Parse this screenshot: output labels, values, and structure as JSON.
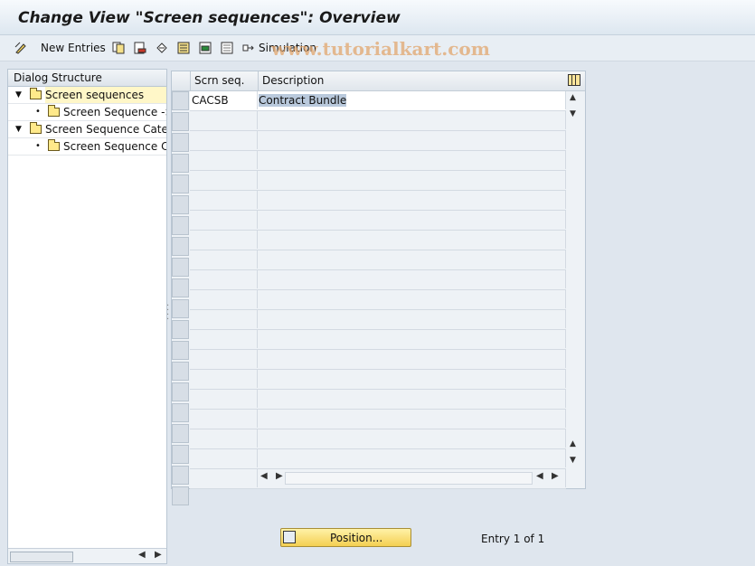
{
  "window": {
    "title": "Change View \"Screen sequences\": Overview"
  },
  "toolbar": {
    "new_entries_label": "New Entries",
    "simulation_label": "Simulation",
    "watermark": "www.tutorialkart.com"
  },
  "dialog_structure": {
    "header": "Dialog Structure",
    "items": [
      {
        "label": "Screen sequences",
        "toggle": "▼",
        "selected": true
      },
      {
        "label": "Screen Sequence -> Screens",
        "bullet": "•"
      },
      {
        "label": "Screen Sequence Category",
        "toggle": "▼"
      },
      {
        "label": "Screen Sequence Category -> Screens",
        "bullet": "•"
      }
    ]
  },
  "table": {
    "columns": [
      "Scrn seq.",
      "Description"
    ],
    "rows": [
      {
        "scrn_seq": "CACSB",
        "description": "Contract Bundle"
      }
    ],
    "visible_rows": 20
  },
  "footer": {
    "position_label": "Position...",
    "entry_text": "Entry 1 of 1"
  }
}
